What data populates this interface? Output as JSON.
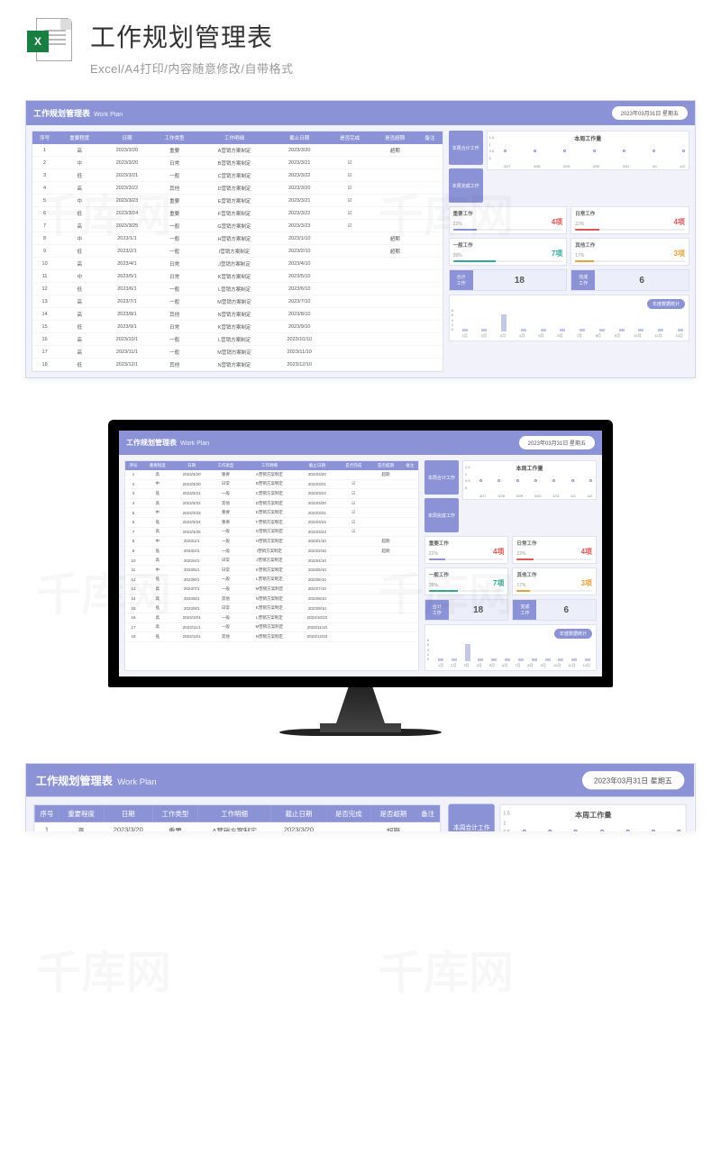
{
  "header": {
    "excel_badge": "X",
    "title": "工作规划管理表",
    "subtitle": "Excel/A4打印/内容随意修改/自带格式"
  },
  "workplan": {
    "title_main": "工作规划管理表",
    "title_sub": "Work Plan",
    "date_badge": "2023年03月31日 星期五",
    "columns": [
      "序号",
      "重要程度",
      "日期",
      "工作类型",
      "工作明细",
      "截止日期",
      "是否完成",
      "是否超期",
      "备注"
    ],
    "rows": [
      {
        "n": "1",
        "imp": "高",
        "date": "2023/3/20",
        "type": "重要",
        "detail": "A营销方案制定",
        "due": "2023/3/20",
        "done": "",
        "over": "超期",
        "note": ""
      },
      {
        "n": "2",
        "imp": "中",
        "date": "2023/3/20",
        "type": "日常",
        "detail": "B营销方案制定",
        "due": "2023/3/21",
        "done": "☑",
        "over": "",
        "note": ""
      },
      {
        "n": "3",
        "imp": "低",
        "date": "2023/3/21",
        "type": "一般",
        "detail": "C营销方案制定",
        "due": "2023/3/22",
        "done": "☑",
        "over": "",
        "note": ""
      },
      {
        "n": "4",
        "imp": "高",
        "date": "2023/3/22",
        "type": "其他",
        "detail": "D营销方案制定",
        "due": "2023/3/20",
        "done": "☑",
        "over": "",
        "note": ""
      },
      {
        "n": "5",
        "imp": "中",
        "date": "2023/3/23",
        "type": "重要",
        "detail": "E营销方案制定",
        "due": "2023/3/21",
        "done": "☑",
        "over": "",
        "note": ""
      },
      {
        "n": "6",
        "imp": "低",
        "date": "2023/3/24",
        "type": "重要",
        "detail": "F营销方案制定",
        "due": "2023/3/22",
        "done": "☑",
        "over": "",
        "note": ""
      },
      {
        "n": "7",
        "imp": "高",
        "date": "2023/3/25",
        "type": "一般",
        "detail": "G营销方案制定",
        "due": "2023/3/23",
        "done": "☑",
        "over": "",
        "note": ""
      },
      {
        "n": "8",
        "imp": "中",
        "date": "2023/1/1",
        "type": "一般",
        "detail": "H营销方案制定",
        "due": "2023/1/10",
        "done": "",
        "over": "超期",
        "note": ""
      },
      {
        "n": "9",
        "imp": "低",
        "date": "2023/2/1",
        "type": "一般",
        "detail": "I营销方案制定",
        "due": "2023/2/10",
        "done": "",
        "over": "超期",
        "note": ""
      },
      {
        "n": "10",
        "imp": "高",
        "date": "2023/4/1",
        "type": "日常",
        "detail": "J营销方案制定",
        "due": "2023/4/10",
        "done": "",
        "over": "",
        "note": ""
      },
      {
        "n": "11",
        "imp": "中",
        "date": "2023/5/1",
        "type": "日常",
        "detail": "K营销方案制定",
        "due": "2023/5/10",
        "done": "",
        "over": "",
        "note": ""
      },
      {
        "n": "12",
        "imp": "低",
        "date": "2023/6/1",
        "type": "一般",
        "detail": "L营销方案制定",
        "due": "2023/6/10",
        "done": "",
        "over": "",
        "note": ""
      },
      {
        "n": "13",
        "imp": "高",
        "date": "2023/7/1",
        "type": "一般",
        "detail": "M营销方案制定",
        "due": "2023/7/10",
        "done": "",
        "over": "",
        "note": ""
      },
      {
        "n": "14",
        "imp": "高",
        "date": "2023/8/1",
        "type": "其他",
        "detail": "N营销方案制定",
        "due": "2023/8/10",
        "done": "",
        "over": "",
        "note": ""
      },
      {
        "n": "15",
        "imp": "低",
        "date": "2023/9/1",
        "type": "日常",
        "detail": "K营销方案制定",
        "due": "2023/9/10",
        "done": "",
        "over": "",
        "note": ""
      },
      {
        "n": "16",
        "imp": "高",
        "date": "2023/10/1",
        "type": "一般",
        "detail": "L营销方案制定",
        "due": "2023/10/10",
        "done": "",
        "over": "",
        "note": ""
      },
      {
        "n": "17",
        "imp": "高",
        "date": "2023/11/1",
        "type": "一般",
        "detail": "M营销方案制定",
        "due": "2023/11/10",
        "done": "",
        "over": "",
        "note": ""
      },
      {
        "n": "18",
        "imp": "低",
        "date": "2023/12/1",
        "type": "其他",
        "detail": "N营销方案制定",
        "due": "2023/12/10",
        "done": "",
        "over": "",
        "note": ""
      }
    ]
  },
  "side": {
    "total_label": "本周合计工作",
    "done_label": "本周完成工作",
    "chart_title": "本周工作量",
    "cards": [
      {
        "label": "重要工作",
        "pct": "22%",
        "val": "4项",
        "color": "#e25555",
        "barcolor": "#8b93d6",
        "barw": 22
      },
      {
        "label": "日常工作",
        "pct": "22%",
        "val": "4项",
        "color": "#e25555",
        "barcolor": "#e25555",
        "barw": 22
      },
      {
        "label": "一般工作",
        "pct": "39%",
        "val": "7项",
        "color": "#3a9",
        "barcolor": "#3a9",
        "barw": 39
      },
      {
        "label": "其他工作",
        "pct": "17%",
        "val": "3项",
        "color": "#e8a23a",
        "barcolor": "#e8a23a",
        "barw": 17
      }
    ],
    "summary": [
      {
        "label": "合计\n工作",
        "val": "18"
      },
      {
        "label": "完成\n工作",
        "val": "6"
      }
    ],
    "yearly_label": "年度数据统计"
  },
  "chart_data": [
    {
      "type": "line",
      "title": "本周工作量",
      "categories": [
        "3/27",
        "3/28",
        "3/29",
        "3/30",
        "3/31",
        "4/1",
        "4/2"
      ],
      "values": [
        0.5,
        0.5,
        0.5,
        0.5,
        0.5,
        0.5,
        0.5
      ],
      "ylim": [
        0,
        1.5
      ],
      "y_ticks": [
        0,
        0.5,
        1,
        1.5
      ],
      "xlabel": "",
      "ylabel": ""
    },
    {
      "type": "bar",
      "title": "年度数据统计",
      "categories": [
        "1月",
        "2月",
        "3月",
        "4月",
        "5月",
        "6月",
        "7月",
        "8月",
        "9月",
        "10月",
        "11月",
        "12月"
      ],
      "values": [
        1,
        1,
        7,
        1,
        1,
        1,
        1,
        1,
        1,
        1,
        1,
        1
      ],
      "ylim": [
        0,
        8
      ],
      "y_ticks": [
        0,
        2,
        4,
        6,
        8
      ],
      "xlabel": "",
      "ylabel": ""
    }
  ],
  "watermark": "千库网"
}
